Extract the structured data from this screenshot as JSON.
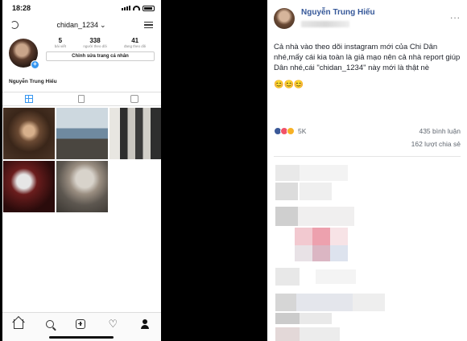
{
  "instagram": {
    "status_time": "18:28",
    "username": "chidan_1234",
    "stats": [
      {
        "value": "5",
        "label": "bài viết"
      },
      {
        "value": "338",
        "label": "người theo dõi"
      },
      {
        "value": "41",
        "label": "đang theo dõi"
      }
    ],
    "edit_button": "Chỉnh sửa trang cá nhân",
    "display_name": "Nguyễn Trung Hiếu",
    "accent_color": "#3897f0",
    "tabs": [
      "grid-icon",
      "feed-icon",
      "tagged-icon"
    ],
    "bottom_nav": [
      "home-icon",
      "search-icon",
      "add-icon",
      "heart-icon",
      "profile-icon"
    ],
    "avatar_plus": "+",
    "heart_glyph": "♡"
  },
  "facebook": {
    "author": "Nguyễn Trung Hiếu",
    "more": "...",
    "post_text": "Cả nhà vào theo dõi instagram mới của Chi Dân nhé,mấy cái kia toàn là giả mạo nên cả nhà report giúp Dân nhé,cái \"chidan_1234\" này mới là thật nè",
    "emoji": "😊😊😊",
    "reaction_count": "5K",
    "comments": "435 bình luận",
    "shares": "162 lượt chia sẻ",
    "name_color": "#365899"
  }
}
